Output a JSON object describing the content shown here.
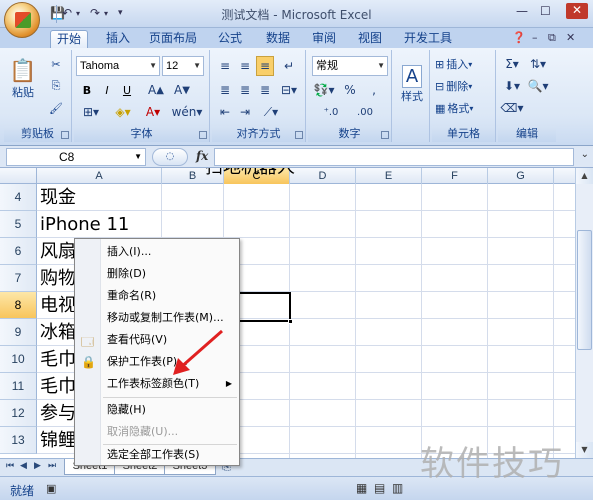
{
  "window": {
    "title": "测试文档 - Microsoft Excel"
  },
  "tabs": [
    {
      "label": "开始",
      "active": true
    },
    {
      "label": "插入"
    },
    {
      "label": "页面布局"
    },
    {
      "label": "公式"
    },
    {
      "label": "数据"
    },
    {
      "label": "审阅"
    },
    {
      "label": "视图"
    },
    {
      "label": "开发工具"
    }
  ],
  "ribbon": {
    "clipboard": {
      "label": "剪贴板",
      "paste": "粘贴"
    },
    "font": {
      "label": "字体",
      "family": "Tahoma",
      "size": "12"
    },
    "alignment": {
      "label": "对齐方式"
    },
    "number": {
      "label": "数字",
      "format": "常规"
    },
    "styles": {
      "label": "样式"
    },
    "cells": {
      "label": "单元格",
      "insert": "插入",
      "delete": "删除",
      "format": "格式"
    },
    "editing": {
      "label": "编辑"
    }
  },
  "formula_bar": {
    "cell_ref": "C8",
    "fx": "fx"
  },
  "columns": [
    "A",
    "B",
    "C",
    "D",
    "E",
    "F",
    "G"
  ],
  "selected_column": "C",
  "rows": [
    {
      "num": "4",
      "a": "现金"
    },
    {
      "num": "5",
      "a": "iPhone 11"
    },
    {
      "num": "6",
      "a": "风扇"
    },
    {
      "num": "7",
      "a": "购物"
    },
    {
      "num": "8",
      "a": "电视"
    },
    {
      "num": "9",
      "a": "冰箱"
    },
    {
      "num": "10",
      "a": "毛巾"
    },
    {
      "num": "11",
      "a": "毛巾"
    },
    {
      "num": "12",
      "a": "参与"
    },
    {
      "num": "13",
      "a": "锦鲤"
    }
  ],
  "selected_row": "8",
  "top_clipped_text": "扫地机器人",
  "context_menu": {
    "items": [
      {
        "label": "插入(I)..."
      },
      {
        "label": "删除(D)"
      },
      {
        "label": "重命名(R)"
      },
      {
        "label": "移动或复制工作表(M)..."
      },
      {
        "label": "查看代码(V)"
      },
      {
        "label": "保护工作表(P)..."
      },
      {
        "label": "工作表标签颜色(T)",
        "submenu": true
      },
      {
        "label": "隐藏(H)"
      },
      {
        "label": "取消隐藏(U)...",
        "disabled": true
      },
      {
        "label": "选定全部工作表(S)"
      }
    ]
  },
  "sheets": [
    "Sheet1",
    "Sheet2",
    "Sheet3"
  ],
  "status": {
    "text": "就绪"
  },
  "watermark": "软件技巧",
  "colors": {
    "ribbon": "#dbe7f6",
    "accent": "#15428b",
    "arrow": "#e02020"
  }
}
